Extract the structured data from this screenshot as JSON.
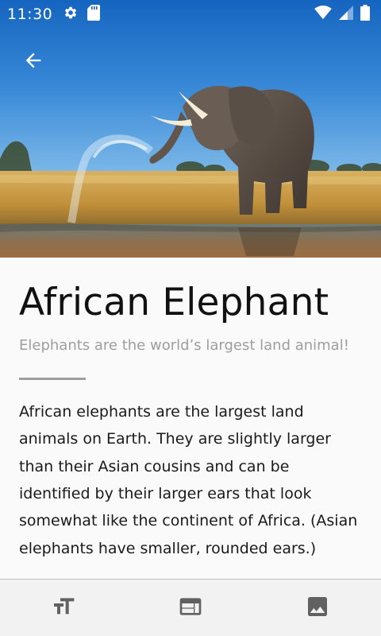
{
  "status_bar": {
    "time": "11:30",
    "icons_left": [
      "settings-gear-icon",
      "sd-card-icon"
    ],
    "icons_right": [
      "wifi-icon",
      "cell-signal-icon",
      "battery-icon"
    ]
  },
  "hero": {
    "image_subject": "elephant-spraying-water-photo"
  },
  "article": {
    "title": "African Elephant",
    "subtitle": "Elephants are the world’s largest land animal!",
    "body": "African elephants are the largest land animals on Earth. They are slightly larger than their Asian cousins and can be identified by their larger ears that look somewhat like the continent of Africa. (Asian elephants have smaller, rounded ears.)"
  },
  "bottom_nav": {
    "items": [
      {
        "icon": "text-size-icon"
      },
      {
        "icon": "web-layout-icon"
      },
      {
        "icon": "image-icon"
      }
    ]
  },
  "colors": {
    "text_primary": "#111111",
    "text_secondary": "#9e9e9e",
    "icon_gray": "#616161",
    "background": "#fafafa",
    "sky_top": "#1565c0"
  }
}
